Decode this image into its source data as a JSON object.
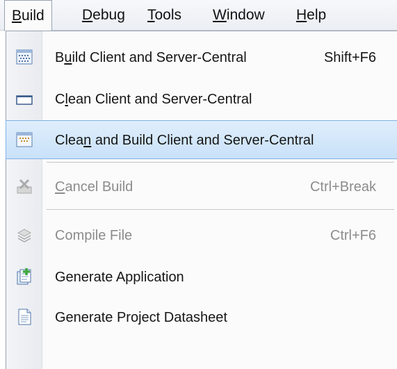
{
  "menubar": {
    "items": [
      {
        "pre": "",
        "key": "B",
        "post": "uild"
      },
      {
        "pre": "",
        "key": "D",
        "post": "ebug"
      },
      {
        "pre": "",
        "key": "T",
        "post": "ools"
      },
      {
        "pre": "",
        "key": "W",
        "post": "indow"
      },
      {
        "pre": "",
        "key": "H",
        "post": "elp"
      }
    ]
  },
  "menu": {
    "items": [
      {
        "pre": "B",
        "key": "u",
        "post": "ild Client and Server-Central",
        "shortcut": "Shift+F6",
        "icon": "build-icon"
      },
      {
        "pre": "C",
        "key": "l",
        "post": "ean Client and Server-Central",
        "shortcut": "",
        "icon": "clean-icon"
      },
      {
        "pre": "Clea",
        "key": "n",
        "post": " and Build Client and Server-Central",
        "shortcut": "",
        "icon": "clean-build-icon"
      },
      {
        "pre": "",
        "key": "C",
        "post": "ancel Build",
        "shortcut": "Ctrl+Break",
        "icon": "cancel-build-icon"
      },
      {
        "pre": "",
        "key": "",
        "post": "Compile File",
        "shortcut": "Ctrl+F6",
        "icon": "compile-file-icon"
      },
      {
        "pre": "",
        "key": "",
        "post": "Generate Application",
        "shortcut": "",
        "icon": "generate-application-icon"
      },
      {
        "pre": "",
        "key": "",
        "post": "Generate Project Datasheet",
        "shortcut": "",
        "icon": "generate-datasheet-icon"
      }
    ]
  },
  "colors": {
    "highlight": "#cfe4fa",
    "highlight_border": "#80b1e4",
    "disabled_text": "#8c8c8c"
  }
}
